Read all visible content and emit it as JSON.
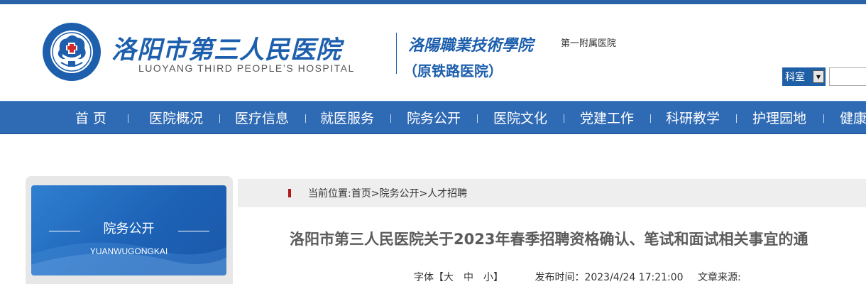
{
  "header": {
    "hospital_name_cn": "洛阳市第三人民医院",
    "hospital_name_en": "LUOYANG THIRD PEOPLE’S HOSPITAL",
    "college_name": "洛陽職業技術學院",
    "affiliate_label": "第一附属医院",
    "former_name": "（原铁路医院）",
    "dept_select_value": "科室",
    "search_value": ""
  },
  "nav": {
    "items": [
      "首 页",
      "医院概况",
      "医疗信息",
      "就医服务",
      "院务公开",
      "医院文化",
      "党建工作",
      "科研教学",
      "护理园地",
      "健康"
    ]
  },
  "sidebar": {
    "title": "院务公开",
    "subtitle": "YUANWUGONGKAI"
  },
  "content": {
    "breadcrumb": "当前位置:首页>院务公开>人才招聘",
    "title": "洛阳市第三人民医院关于2023年春季招聘资格确认、笔试和面试相关事宜的通",
    "meta": {
      "font_size_label": "字体【大　中　小】",
      "publish_time": "发布时间：2023/4/24 17:21:00",
      "source": "文章来源:"
    }
  },
  "colors": {
    "brand_blue": "#1d5fad",
    "nav_blue": "#2f6ab4",
    "breadcrumb_marker": "#b01818"
  }
}
